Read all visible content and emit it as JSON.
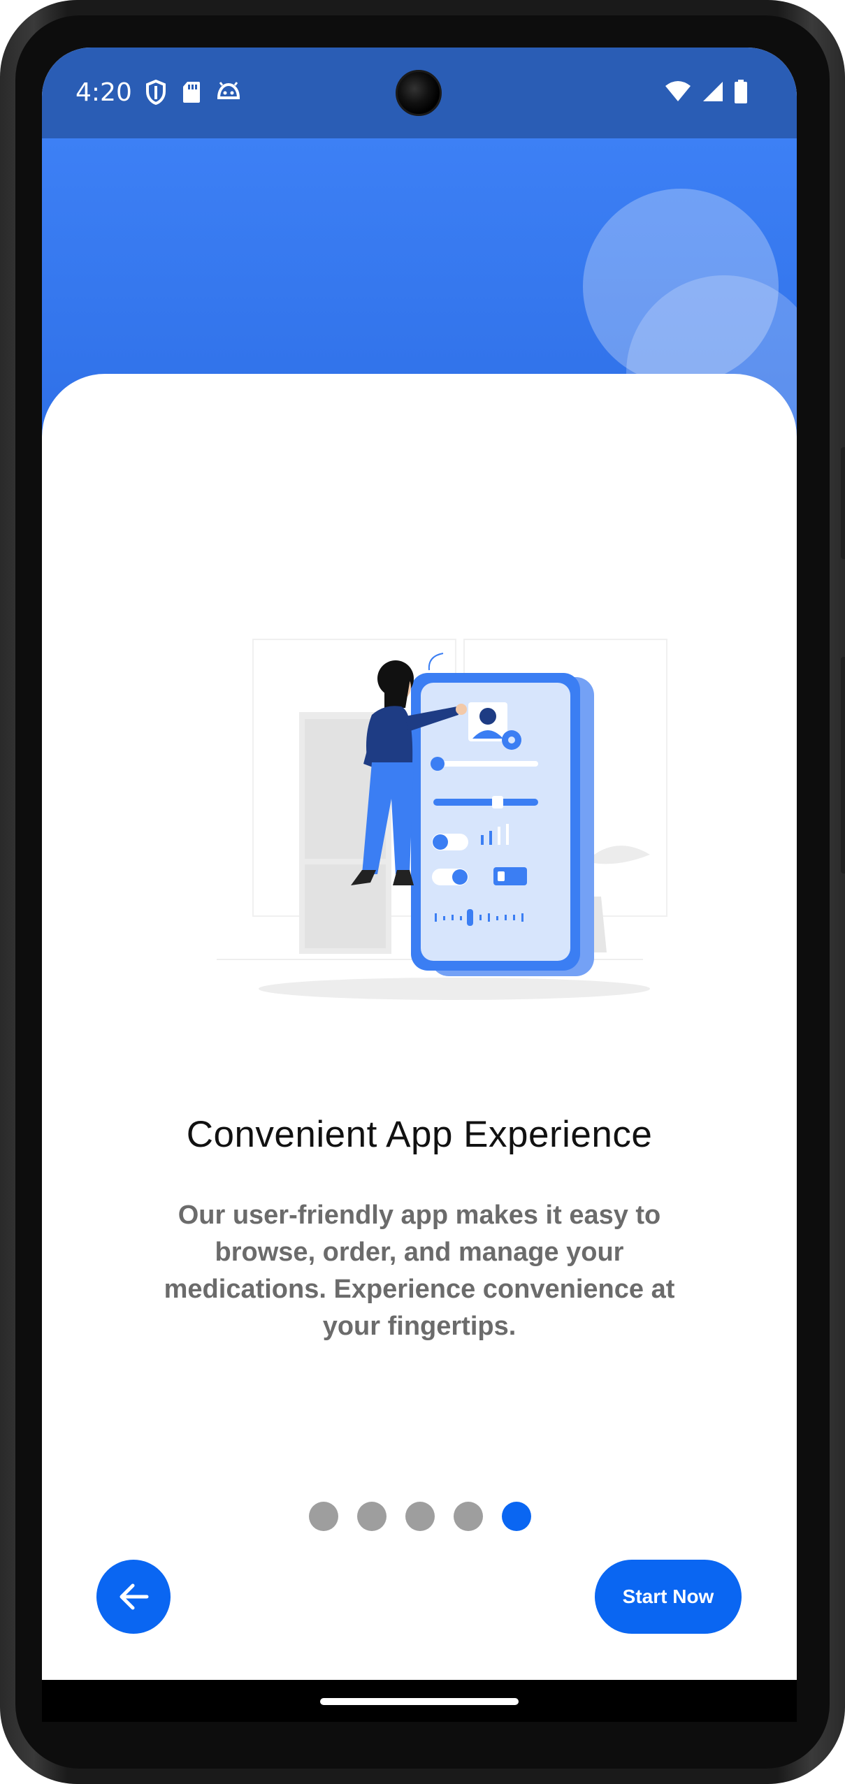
{
  "status_bar": {
    "time": "4:20",
    "left_icons": [
      "shield-icon",
      "sd-card-icon",
      "android-face-icon"
    ],
    "right_icons": [
      "wifi-icon",
      "signal-icon",
      "battery-icon"
    ]
  },
  "onboarding": {
    "title": "Convenient App Experience",
    "description": "Our user-friendly app makes it easy to browse, order, and manage your medications. Experience convenience at your fingertips.",
    "page_indicator": {
      "total": 5,
      "current": 5
    },
    "back_icon": "arrow-left-icon",
    "start_label": "Start Now"
  },
  "colors": {
    "primary": "#0a66f2",
    "hero_top": "#3d80f5",
    "status_bar": "#2a5db5",
    "inactive_dot": "#9e9e9e",
    "title_text": "#111111",
    "body_text": "#6b6b6b"
  }
}
